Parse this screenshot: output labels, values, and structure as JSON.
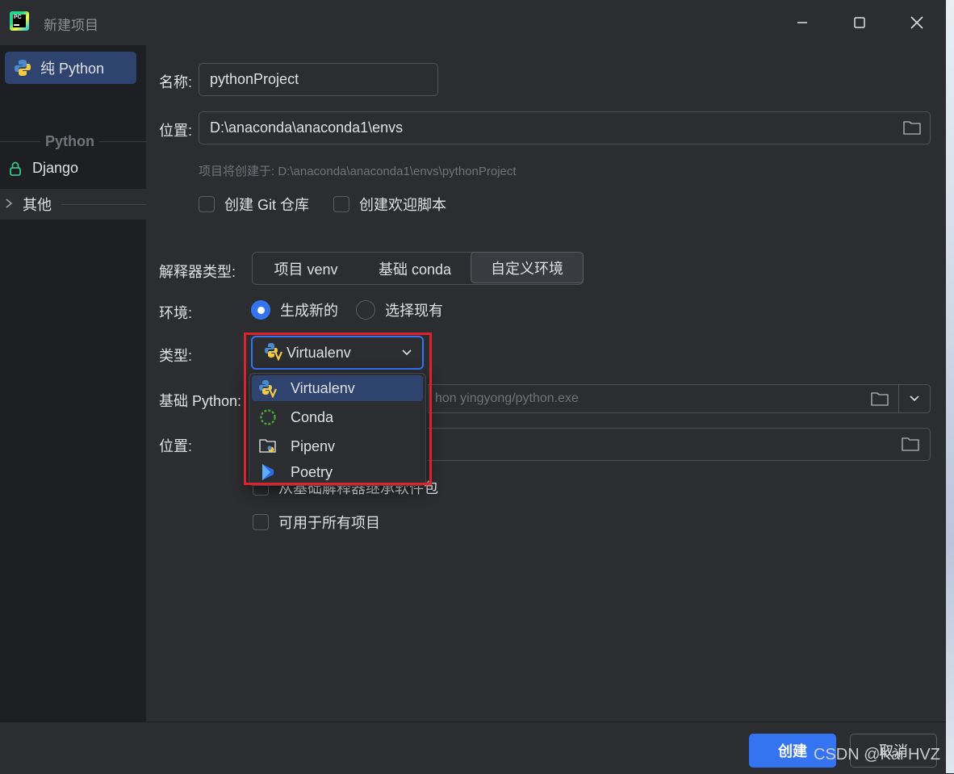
{
  "window": {
    "title": "新建项目"
  },
  "sidebar": {
    "items": [
      {
        "label": "纯 Python",
        "icon": "python-icon",
        "selected": true
      }
    ],
    "group_label": "Python",
    "django_label": "Django",
    "other_label": "其他"
  },
  "form": {
    "name_label": "名称:",
    "name_value": "pythonProject",
    "location_label": "位置:",
    "location_value": "D:\\anaconda\\anaconda1\\envs",
    "create_hint": "项目将创建于: D:\\anaconda\\anaconda1\\envs\\pythonProject",
    "git_checkbox": "创建 Git 仓库",
    "welcome_checkbox": "创建欢迎脚本",
    "interpreter_type_label": "解释器类型:",
    "interpreter_tabs": [
      "项目 venv",
      "基础 conda",
      "自定义环境"
    ],
    "interpreter_active": "自定义环境",
    "env_label": "环境:",
    "env_new": "生成新的",
    "env_existing": "选择现有",
    "type_label": "类型:",
    "type_value": "Virtualenv",
    "base_python_label": "基础 Python:",
    "base_python_value": "hon  yingyong/python.exe",
    "env_location_label": "位置:",
    "inherit_checkbox": "从基础解释器继承软件包",
    "all_projects_checkbox": "可用于所有项目"
  },
  "type_dropdown": {
    "options": [
      {
        "label": "Virtualenv",
        "icon": "virtualenv-icon",
        "selected": true
      },
      {
        "label": "Conda",
        "icon": "conda-icon"
      },
      {
        "label": "Pipenv",
        "icon": "pipenv-icon"
      },
      {
        "label": "Poetry",
        "icon": "poetry-icon"
      }
    ]
  },
  "footer": {
    "create_button": "创建",
    "cancel_button": "取消"
  },
  "watermark": "CSDN @Kai  HVZ",
  "colors": {
    "accent": "#3574f0",
    "highlight_box": "#e0202a",
    "background": "#2b2d30",
    "sidebar": "#1e1f22"
  }
}
